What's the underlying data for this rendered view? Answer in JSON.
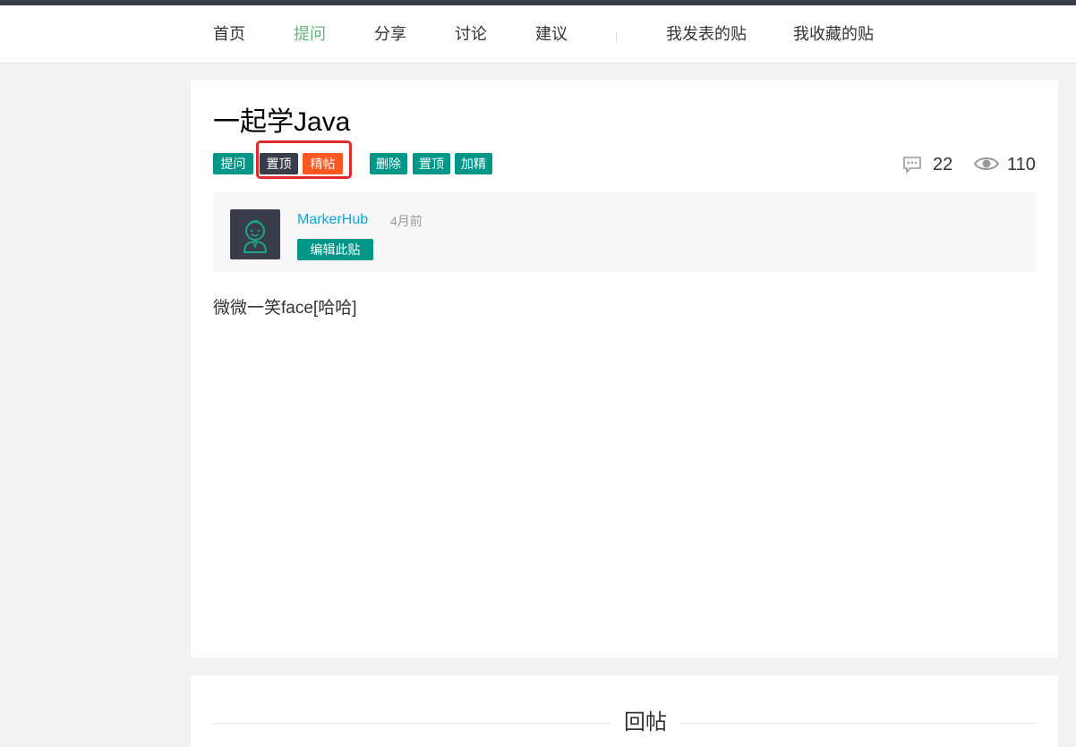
{
  "nav": {
    "items": [
      {
        "label": "首页"
      },
      {
        "label": "提问",
        "active": true
      },
      {
        "label": "分享"
      },
      {
        "label": "讨论"
      },
      {
        "label": "建议"
      }
    ],
    "my_posts": "我发表的贴",
    "my_favorites": "我收藏的贴"
  },
  "post": {
    "title": "一起学Java",
    "tags": {
      "category": "提问",
      "top": "置顶",
      "featured": "精帖"
    },
    "admin": {
      "delete": "删除",
      "set_top": "置顶",
      "add_featured": "加精"
    },
    "stats": {
      "comments": "22",
      "views": "110"
    },
    "author": {
      "name": "MarkerHub",
      "time": "4月前",
      "edit_label": "编辑此贴"
    },
    "content": "微微一笑face[哈哈]"
  },
  "reply": {
    "title": "回帖"
  },
  "colors": {
    "accent": "#009688",
    "active_nav": "#5fb878",
    "featured": "#ff5722",
    "top_tag": "#393d49",
    "link": "#01aaed",
    "highlight_box": "#e5282a"
  }
}
